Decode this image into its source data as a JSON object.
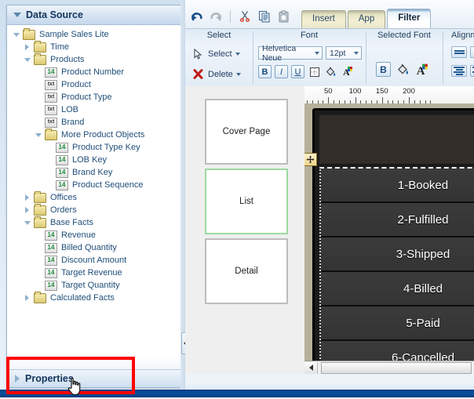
{
  "left_panel": {
    "header": {
      "title": "Data Source",
      "toggle_icon": "triangle-down-icon"
    },
    "tree": [
      {
        "label": "Sample Sales Lite",
        "depth": 0,
        "icon": "folder-icon",
        "twisty": "expanded"
      },
      {
        "label": "Time",
        "depth": 1,
        "icon": "folder-icon",
        "twisty": "collapsed"
      },
      {
        "label": "Products",
        "depth": 1,
        "icon": "folder-icon",
        "twisty": "expanded"
      },
      {
        "label": "Product Number",
        "depth": 2,
        "icon": "number-badge",
        "badge": "14",
        "twisty": "none"
      },
      {
        "label": "Product",
        "depth": 2,
        "icon": "text-badge",
        "badge": "txt",
        "twisty": "none"
      },
      {
        "label": "Product Type",
        "depth": 2,
        "icon": "text-badge",
        "badge": "txt",
        "twisty": "none"
      },
      {
        "label": "LOB",
        "depth": 2,
        "icon": "text-badge",
        "badge": "txt",
        "twisty": "none"
      },
      {
        "label": "Brand",
        "depth": 2,
        "icon": "text-badge",
        "badge": "txt",
        "twisty": "none"
      },
      {
        "label": "More Product Objects",
        "depth": 2,
        "icon": "folder-icon",
        "twisty": "expanded"
      },
      {
        "label": "Product Type Key",
        "depth": 3,
        "icon": "number-badge",
        "badge": "14",
        "twisty": "none"
      },
      {
        "label": "LOB Key",
        "depth": 3,
        "icon": "number-badge",
        "badge": "14",
        "twisty": "none"
      },
      {
        "label": "Brand Key",
        "depth": 3,
        "icon": "number-badge",
        "badge": "14",
        "twisty": "none"
      },
      {
        "label": "Product Sequence",
        "depth": 3,
        "icon": "number-badge",
        "badge": "14",
        "twisty": "none"
      },
      {
        "label": "Offices",
        "depth": 1,
        "icon": "folder-icon",
        "twisty": "collapsed"
      },
      {
        "label": "Orders",
        "depth": 1,
        "icon": "folder-icon",
        "twisty": "collapsed"
      },
      {
        "label": "Base Facts",
        "depth": 1,
        "icon": "folder-icon",
        "twisty": "expanded"
      },
      {
        "label": "Revenue",
        "depth": 2,
        "icon": "number-badge",
        "badge": "14",
        "twisty": "none"
      },
      {
        "label": "Billed Quantity",
        "depth": 2,
        "icon": "number-badge",
        "badge": "14",
        "twisty": "none"
      },
      {
        "label": "Discount Amount",
        "depth": 2,
        "icon": "number-badge",
        "badge": "14",
        "twisty": "none"
      },
      {
        "label": "Target Revenue",
        "depth": 2,
        "icon": "number-badge",
        "badge": "14",
        "twisty": "none"
      },
      {
        "label": "Target Quantity",
        "depth": 2,
        "icon": "number-badge",
        "badge": "14",
        "twisty": "none"
      },
      {
        "label": "Calculated Facts",
        "depth": 1,
        "icon": "folder-icon",
        "twisty": "collapsed"
      }
    ],
    "properties_bar": {
      "label": "Properties",
      "toggle_icon": "triangle-right-icon"
    }
  },
  "toolbar": {
    "quick_tools": [
      {
        "name": "undo-icon",
        "state": "enabled"
      },
      {
        "name": "redo-icon",
        "state": "disabled"
      },
      {
        "name": "cut-icon",
        "state": "enabled"
      },
      {
        "name": "copy-icon",
        "state": "enabled"
      },
      {
        "name": "paste-icon",
        "state": "enabled"
      }
    ]
  },
  "tabs": [
    {
      "label": "Insert",
      "active": false
    },
    {
      "label": "App",
      "active": false
    },
    {
      "label": "Filter",
      "active": true
    }
  ],
  "ribbon": {
    "groups": [
      {
        "title": "Select"
      },
      {
        "title": "Font"
      },
      {
        "title": "Selected Font"
      },
      {
        "title": "Alignment"
      }
    ],
    "select_group": {
      "select_label": "Select",
      "select_icon": "cursor-arrow-icon",
      "delete_label": "Delete",
      "delete_icon": "red-x-icon"
    },
    "font_group": {
      "font_family": "Helvetica Neue",
      "font_size": "12pt",
      "bold_label": "B",
      "italic_label": "I",
      "underline_label": "U",
      "border_icon": "border-icon",
      "fill_icon": "fill-bucket-icon",
      "font_color_icon": "font-color-icon"
    },
    "selected_font_group": {
      "bold_label": "B",
      "fill_icon": "fill-bucket-icon",
      "font_color_icon": "font-color-icon"
    }
  },
  "pages": [
    {
      "label": "Cover Page",
      "selected": false
    },
    {
      "label": "List",
      "selected": true
    },
    {
      "label": "Detail",
      "selected": false
    }
  ],
  "canvas": {
    "ruler_ticks": [
      50,
      100,
      150,
      200
    ],
    "rows": [
      "1-Booked",
      "2-Fulfilled",
      "3-Shipped",
      "4-Billed",
      "5-Paid",
      "6-Cancelled"
    ],
    "move_handle_icon": "move-handle-icon",
    "scroll_left_icon": "scroll-left-arrow-icon"
  },
  "annotation": {
    "highlight_color": "#ff0000",
    "cursor_icon": "pointing-hand-cursor"
  },
  "colors": {
    "selected_page_border": "#9ed9a0",
    "selection_border": "#e8a33d",
    "active_tab_bg": "#ffffff",
    "inactive_tab_bg": "#efecd4"
  }
}
